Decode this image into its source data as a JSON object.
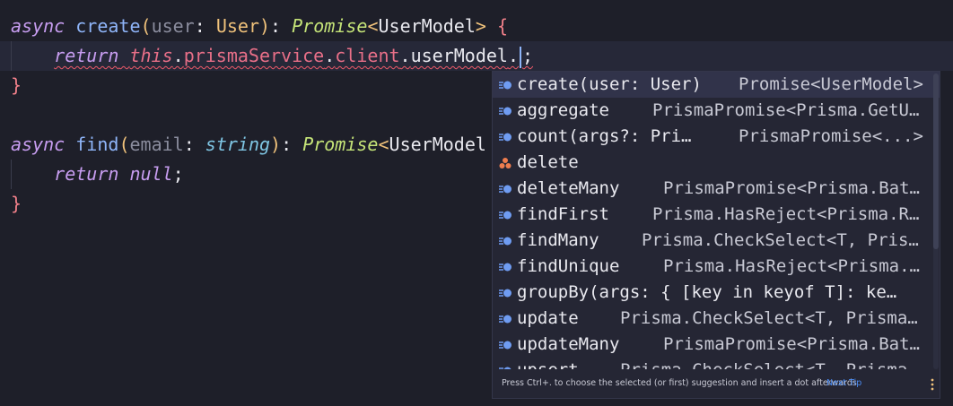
{
  "colors": {
    "background": "#1e1f29",
    "keyword": "#c79df0",
    "function": "#8fb5f9",
    "type": "#f0c27b",
    "error_underline": "#ef5a6a",
    "link": "#4c8df5",
    "method_icon": "#6f9cf2",
    "field_icon": "#ef7d4e"
  },
  "code": {
    "line1": {
      "kw_async": "async",
      "fn_name": "create",
      "open_paren": "(",
      "param": "user",
      "colon": ": ",
      "param_type": "User",
      "close_paren": ")",
      "colon2": ": ",
      "return_type": "Promise",
      "generic_open": "<",
      "generic_arg": "UserModel",
      "generic_close": ">",
      "open_brace": " {"
    },
    "line2": {
      "kw_return": "return",
      "space": " ",
      "this": "this",
      "dot1": ".",
      "prop1": "prismaService",
      "dot2": ".",
      "prop2": "client",
      "dot3": ".",
      "prop3": "userModel",
      "dot4": ".",
      "semicolon": ";"
    },
    "line3": {
      "close_brace": "}"
    },
    "line5": {
      "kw_async": "async",
      "fn_name": "find",
      "open_paren": "(",
      "param": "email",
      "colon": ": ",
      "param_type": "string",
      "close_paren": ")",
      "colon2": ": ",
      "return_type": "Promise",
      "generic_open": "<",
      "generic_arg": "UserModel"
    },
    "line6": {
      "kw_return": "return",
      "space": " ",
      "value": "null",
      "semicolon": ";"
    },
    "line7": {
      "close_brace": "}"
    }
  },
  "completion": {
    "suggestions": [
      {
        "icon": "method-icon",
        "name": "create(user: User)",
        "type": "Promise<UserModel>",
        "selected": true
      },
      {
        "icon": "method-icon",
        "name": "aggregate",
        "type": "PrismaPromise<Prisma.GetU…"
      },
      {
        "icon": "method-icon",
        "name": "count(args?: Pri…",
        "type": "PrismaPromise<...>"
      },
      {
        "icon": "field-icon",
        "name": "delete",
        "type": ""
      },
      {
        "icon": "method-icon",
        "name": "deleteMany",
        "type": "PrismaPromise<Prisma.Bat…"
      },
      {
        "icon": "method-icon",
        "name": "findFirst",
        "type": "Prisma.HasReject<Prisma.R…"
      },
      {
        "icon": "method-icon",
        "name": "findMany",
        "type": "Prisma.CheckSelect<T, Pris…"
      },
      {
        "icon": "method-icon",
        "name": "findUnique",
        "type": "Prisma.HasReject<Prisma.…"
      },
      {
        "icon": "method-icon",
        "name": "groupBy(args: { [key in keyof T]: ke…",
        "type": ""
      },
      {
        "icon": "method-icon",
        "name": "update",
        "type": "Prisma.CheckSelect<T, Prisma…"
      },
      {
        "icon": "method-icon",
        "name": "updateMany",
        "type": "PrismaPromise<Prisma.Bat…"
      },
      {
        "icon": "method-icon",
        "name": "upsert",
        "type": "Prisma.CheckSelect<T, Prisma…"
      }
    ],
    "footer": {
      "hint": "Press Ctrl+. to choose the selected (or first) suggestion and insert a dot afterwards",
      "next_tip": "Next Tip",
      "more_icon": "kebab-menu-icon"
    }
  }
}
